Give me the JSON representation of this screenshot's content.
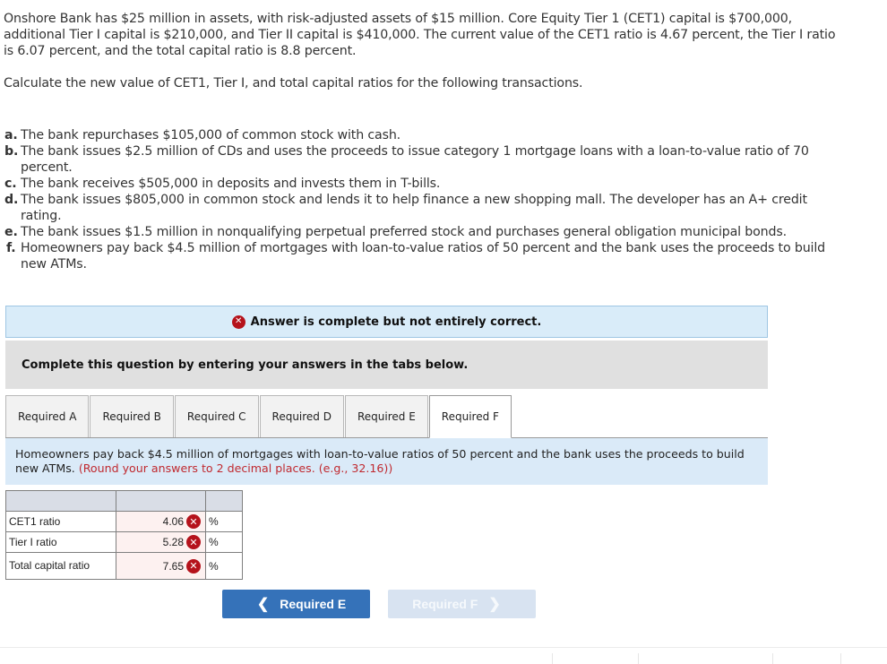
{
  "question": {
    "intro": "Onshore Bank has $25 million in assets, with risk-adjusted assets of $15 million. Core Equity Tier 1 (CET1) capital is $700,000, additional Tier I capital is $210,000, and Tier II capital is $410,000. The current value of the CET1 ratio is 4.67 percent, the Tier I ratio is 6.07 percent, and the total capital ratio is 8.8 percent.",
    "prompt": "Calculate the new value of CET1, Tier I, and total capital ratios for the following transactions.",
    "parts": [
      {
        "letter": "a.",
        "text": "The bank repurchases $105,000 of common stock with cash."
      },
      {
        "letter": "b.",
        "text": "The bank issues $2.5 million of CDs and uses the proceeds to issue category 1 mortgage loans with a loan-to-value ratio of 70 percent."
      },
      {
        "letter": "c.",
        "text": "The bank receives $505,000 in deposits and invests them in T-bills."
      },
      {
        "letter": "d.",
        "text": "The bank issues $805,000 in common stock and lends it to help finance a new shopping mall. The developer has an A+ credit rating."
      },
      {
        "letter": "e.",
        "text": "The bank issues $1.5 million in nonqualifying perpetual preferred stock and purchases general obligation municipal bonds."
      },
      {
        "letter": "f.",
        "text": "Homeowners pay back $4.5 million of mortgages with loan-to-value ratios of 50 percent and the bank uses the proceeds to build new ATMs."
      }
    ]
  },
  "alert": {
    "icon": "x-circle-icon",
    "text": "Answer is complete but not entirely correct."
  },
  "instructions": "Complete this question by entering your answers in the tabs below.",
  "tabs": [
    {
      "label": "Required A",
      "active": false
    },
    {
      "label": "Required B",
      "active": false
    },
    {
      "label": "Required C",
      "active": false
    },
    {
      "label": "Required D",
      "active": false
    },
    {
      "label": "Required E",
      "active": false
    },
    {
      "label": "Required F",
      "active": true
    }
  ],
  "panel": {
    "description": "Homeowners pay back $4.5 million of mortgages with loan-to-value ratios of 50 percent and the bank uses the proceeds to build new ATMs.",
    "hint": "(Round your answers to 2 decimal places. (e.g., 32.16))"
  },
  "answers": {
    "rows": [
      {
        "label": "CET1 ratio",
        "value": "4.06",
        "status": "incorrect",
        "unit": "%"
      },
      {
        "label": "Tier I ratio",
        "value": "5.28",
        "status": "incorrect",
        "unit": "%"
      },
      {
        "label": "Total capital ratio",
        "value": "7.65",
        "status": "incorrect",
        "unit": "%"
      }
    ]
  },
  "navigation": {
    "prev_label": "Required E",
    "next_label": "Required F"
  },
  "colors": {
    "primary_button": "#3572b9",
    "disabled_button": "#d8e3f1",
    "error_red": "#b5121b",
    "hint_red": "#c0292f",
    "alert_bg": "#d9ecf9"
  }
}
